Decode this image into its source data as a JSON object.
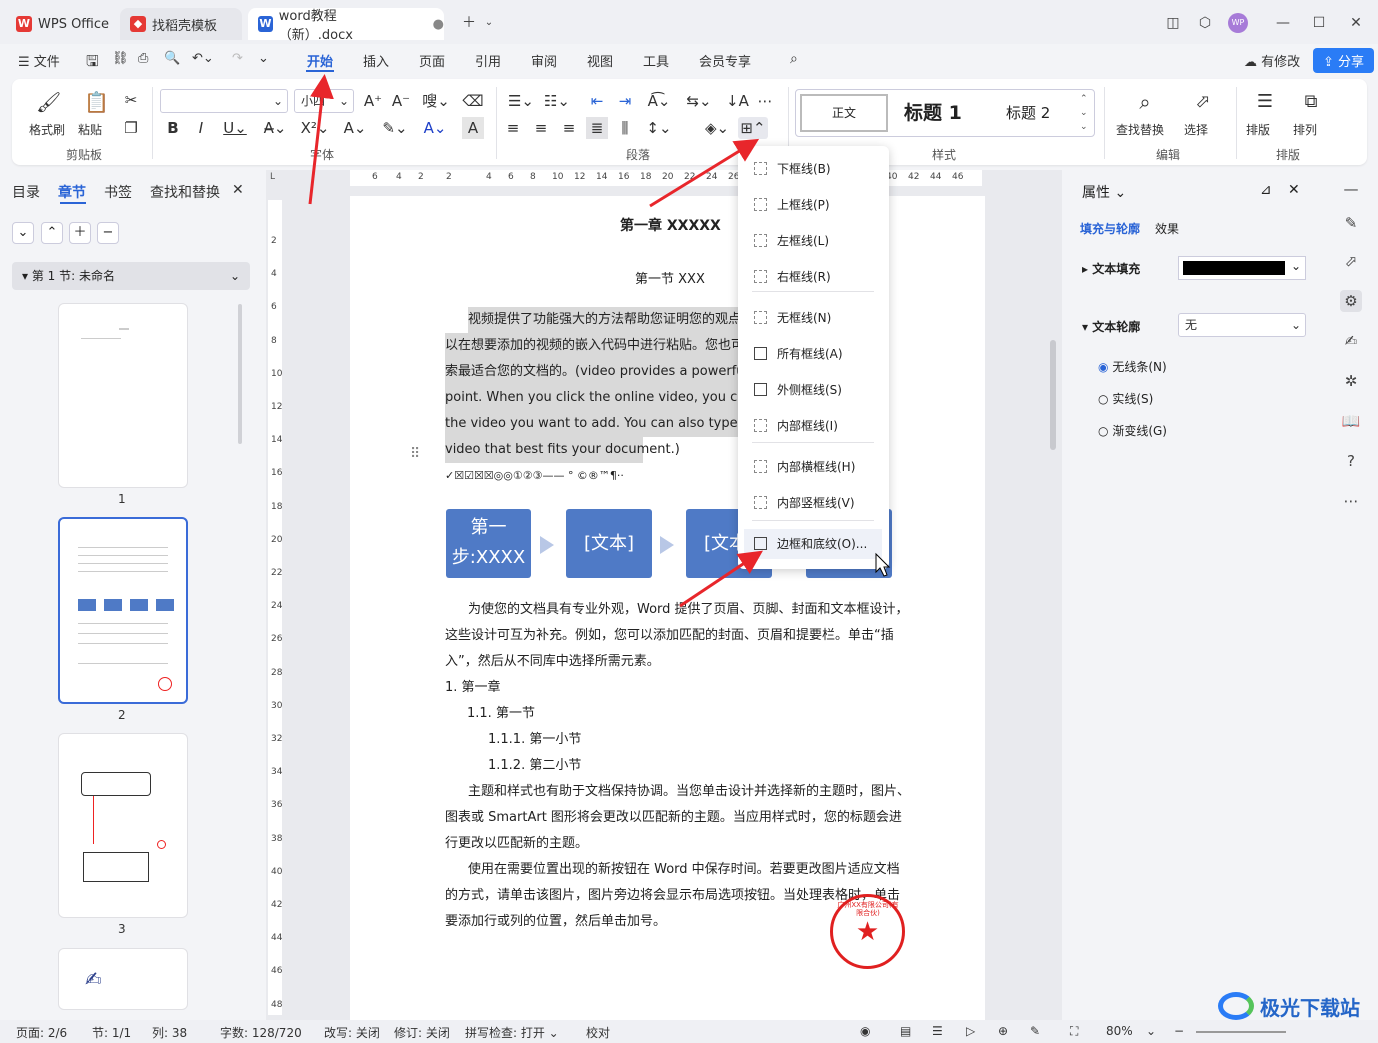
{
  "tabs": [
    {
      "label": "WPS Office"
    },
    {
      "label": "找稻壳模板"
    },
    {
      "label": "word教程（新）.docx"
    }
  ],
  "menu": {
    "file": "文件",
    "items": [
      "开始",
      "插入",
      "页面",
      "引用",
      "审阅",
      "视图",
      "工具",
      "会员专享"
    ],
    "modified": "有修改",
    "share": "分享"
  },
  "ribbon": {
    "format_painter": "格式刷",
    "paste": "粘贴",
    "font_size": "小四",
    "styles": [
      "正文",
      "标题 1",
      "标题 2"
    ],
    "find_replace": "查找替换",
    "select": "选择",
    "layout": "排版",
    "arrange": "排列",
    "groups": {
      "clipboard": "剪贴板",
      "font": "字体",
      "paragraph": "段落",
      "styles": "样式",
      "edit": "编辑",
      "layout": "排版"
    }
  },
  "leftpane": {
    "tabs": [
      "目录",
      "章节",
      "书签",
      "查找和替换"
    ],
    "section": "第 1 节: 未命名",
    "pages": [
      "1",
      "2",
      "3"
    ]
  },
  "ruler": {
    "h": [
      "6",
      "4",
      "2",
      "2",
      "4",
      "6",
      "8",
      "10",
      "12",
      "14",
      "16",
      "18",
      "20",
      "22",
      "24",
      "26",
      "40",
      "42",
      "44",
      "46"
    ],
    "v": [
      "2",
      "4",
      "6",
      "8",
      "10",
      "12",
      "14",
      "16",
      "18",
      "20",
      "22",
      "24",
      "26",
      "28",
      "30",
      "32",
      "34",
      "36",
      "38",
      "40",
      "42",
      "44",
      "46",
      "48"
    ]
  },
  "doc": {
    "chapter": "第一章  XXXXX",
    "section": "第一节  XXX",
    "p1": [
      "视频提供了功能强大的方法帮助您证明您的观点",
      "以在想要添加的视频的嵌入代码中进行粘贴。您也可",
      "索最适合您的文档的。(video provides a powerful",
      "point. When you click the online video, you can paste",
      "the video you want to add. You can also type a keyw",
      "video that best fits your document.)"
    ],
    "symbols": "✓☒☑☒☒◎◎①②③——  ° ©®™¶··",
    "flow": [
      "第一步:XXXX",
      "[文本]",
      "[文本]",
      ""
    ],
    "p2": [
      "为使您的文档具有专业外观，Word 提供了页眉、页脚、封面和文本框设计，",
      "这些设计可互为补充。例如，您可以添加匹配的封面、页眉和提要栏。单击“插",
      "入”，然后从不同库中选择所需元素。"
    ],
    "list": [
      "1.   第一章",
      "1.1.  第一节",
      "1.1.1.   第一小节",
      "1.1.2.   第二小节"
    ],
    "p3": [
      "主题和样式也有助于文档保持协调。当您单击设计并选择新的主题时，图片、",
      "图表或 SmartArt 图形将会更改以匹配新的主题。当应用样式时，您的标题会进",
      "行更改以匹配新的主题。"
    ],
    "p4": [
      "使用在需要位置出现的新按钮在 Word 中保存时间。若要更改图片适应文档",
      "的方式，请单击该图片，图片旁边将会显示布局选项按钮。当处理表格时，单击",
      "要添加行或列的位置，然后单击加号。"
    ],
    "seal": "广州XX有限公司(有限合伙)"
  },
  "dropdown": [
    "下框线(B)",
    "上框线(P)",
    "左框线(L)",
    "右框线(R)",
    "无框线(N)",
    "所有框线(A)",
    "外侧框线(S)",
    "内部框线(I)",
    "内部横框线(H)",
    "内部竖框线(V)",
    "边框和底纹(O)..."
  ],
  "rightpane": {
    "title": "属性",
    "tabs": [
      "填充与轮廓",
      "效果"
    ],
    "text_fill": "文本填充",
    "text_outline": "文本轮廓",
    "outline_value": "无",
    "options": [
      "无线条(N)",
      "实线(S)",
      "渐变线(G)"
    ]
  },
  "status": {
    "page": "页面: 2/6",
    "section": "节: 1/1",
    "col": "列: 38",
    "words": "字数: 128/720",
    "rewrite": "改写: 关闭",
    "revise": "修订: 关闭",
    "spell": "拼写检查: 打开",
    "proof": "校对",
    "zoom": "80%"
  },
  "watermark": "极光下载站"
}
